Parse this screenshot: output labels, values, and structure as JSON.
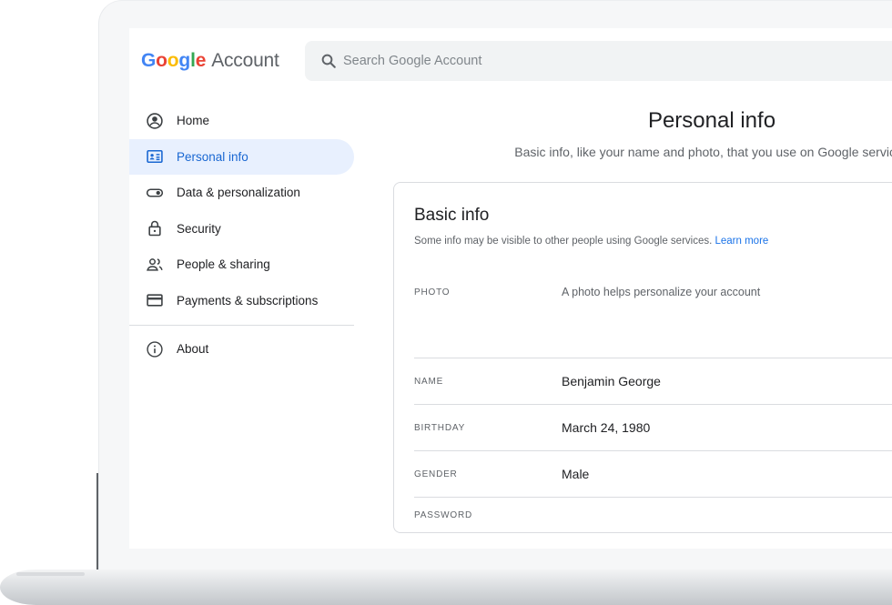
{
  "header": {
    "logo_word": "Google",
    "logo_suffix": "Account",
    "search_placeholder": "Search Google Account"
  },
  "sidebar": {
    "items": [
      {
        "label": "Home",
        "icon": "account-circle-icon"
      },
      {
        "label": "Personal info",
        "icon": "id-card-icon",
        "active": true
      },
      {
        "label": "Data & personalization",
        "icon": "toggle-icon"
      },
      {
        "label": "Security",
        "icon": "lock-icon"
      },
      {
        "label": "People & sharing",
        "icon": "people-icon"
      },
      {
        "label": "Payments & subscriptions",
        "icon": "credit-card-icon"
      }
    ],
    "about": {
      "label": "About",
      "icon": "info-icon"
    }
  },
  "main": {
    "title": "Personal info",
    "subtitle": "Basic info, like your name and photo, that you use on Google services"
  },
  "card": {
    "title": "Basic info",
    "description": "Some info may be visible to other people using Google services.",
    "learn_more": "Learn more",
    "rows": [
      {
        "label": "PHOTO",
        "value": "A photo helps personalize your account"
      },
      {
        "label": "NAME",
        "value": "Benjamin George"
      },
      {
        "label": "BIRTHDAY",
        "value": "March 24, 1980"
      },
      {
        "label": "GENDER",
        "value": "Male"
      },
      {
        "label": "PASSWORD",
        "value": ""
      }
    ]
  },
  "colors": {
    "accent_blue": "#1a73e8",
    "active_bg": "#e8f0fe",
    "logo_blue": "#4285f4",
    "logo_red": "#ea4335",
    "logo_yellow": "#fbbc05",
    "logo_green": "#34a853"
  }
}
